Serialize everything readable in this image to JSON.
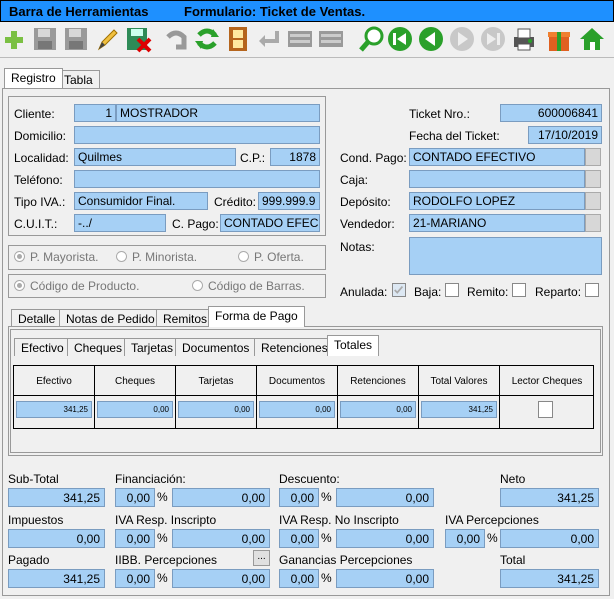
{
  "window": {
    "toolbar_title": "Barra de Herramientas",
    "form_title": "Formulario: Ticket de Ventas."
  },
  "toolbar_icons": [
    "add-icon",
    "save-icon",
    "save-as-icon",
    "edit-icon",
    "save-exit-icon",
    "undo-icon",
    "refresh-icon",
    "film-icon",
    "return-icon",
    "list-icon",
    "list2-icon",
    "search-icon",
    "first-icon",
    "prev-icon",
    "next-icon",
    "last-icon",
    "print-icon",
    "gift-icon",
    "home-icon"
  ],
  "main_tabs": [
    "Registro",
    "Tabla"
  ],
  "cliente": {
    "cliente_label": "Cliente:",
    "cliente_num": "1",
    "cliente_name": "MOSTRADOR",
    "domicilio_label": "Domicilio:",
    "domicilio": "",
    "localidad_label": "Localidad:",
    "localidad": "Quilmes",
    "cp_label": "C.P.:",
    "cp": "1878",
    "telefono_label": "Teléfono:",
    "telefono": "",
    "tipo_iva_label": "Tipo IVA.:",
    "tipo_iva": "Consumidor Final.",
    "credito_label": "Crédito:",
    "credito": "999.999.9",
    "cuit_label": "C.U.I.T.:",
    "cuit": "-../",
    "cpago_label": "C. Pago:",
    "cpago": "CONTADO EFEC"
  },
  "ticket": {
    "nro_label": "Ticket Nro.:",
    "nro": "600006841",
    "fecha_label": "Fecha del Ticket:",
    "fecha": "17/10/2019",
    "cond_pago_label": "Cond. Pago:",
    "cond_pago": "CONTADO EFECTIVO",
    "caja_label": "Caja:",
    "caja": "",
    "deposito_label": "Depósito:",
    "deposito": "RODOLFO LOPEZ",
    "vendedor_label": "Vendedor:",
    "vendedor": "21-MARIANO",
    "notas_label": "Notas:",
    "notas": ""
  },
  "precios": {
    "mayorista": "P. Mayorista.",
    "minorista": "P. Minorista.",
    "oferta": "P. Oferta."
  },
  "codigos": {
    "producto": "Código de Producto.",
    "barras": "Código de Barras."
  },
  "flags": {
    "anulada": "Anulada:",
    "baja": "Baja:",
    "remito": "Remito:",
    "reparto": "Reparto:"
  },
  "sub_tabs": [
    "Detalle",
    "Notas de Pedido",
    "Remitos",
    "Forma de Pago"
  ],
  "pago_tabs": [
    "Efectivo",
    "Cheques",
    "Tarjetas",
    "Documentos",
    "Retenciones",
    "Totales"
  ],
  "grid": {
    "headers": [
      "Efectivo",
      "Cheques",
      "Tarjetas",
      "Documentos",
      "Retenciones",
      "Total Valores",
      "Lector Cheques"
    ],
    "row": [
      "341,25",
      "0,00",
      "0,00",
      "0,00",
      "0,00",
      "341,25"
    ]
  },
  "totals": {
    "subtotal_label": "Sub-Total",
    "subtotal": "341,25",
    "financiacion_label": "Financiación:",
    "financiacion_pct": "0,00",
    "financiacion": "0,00",
    "descuento_label": "Descuento:",
    "descuento_pct": "0,00",
    "descuento": "0,00",
    "neto_label": "Neto",
    "neto": "341,25",
    "impuestos_label": "Impuestos",
    "impuestos": "0,00",
    "iva_ri_label": "IVA Resp. Inscripto",
    "iva_ri_pct": "0,00",
    "iva_ri": "0,00",
    "iva_rni_label": "IVA Resp. No Inscripto",
    "iva_rni_pct": "0,00",
    "iva_rni": "0,00",
    "iva_perc_label": "IVA Percepciones",
    "iva_perc_pct": "0,00",
    "iva_perc": "0,00",
    "pagado_label": "Pagado",
    "pagado": "341,25",
    "iibb_label": "IIBB. Percepciones",
    "iibb_btn": "...",
    "iibb_pct": "0,00",
    "iibb": "0,00",
    "ganancias_label": "Ganancias Percepciones",
    "ganancias_pct": "0,00",
    "ganancias": "0,00",
    "total_label": "Total",
    "total": "341,25",
    "pct_sign": "%"
  }
}
